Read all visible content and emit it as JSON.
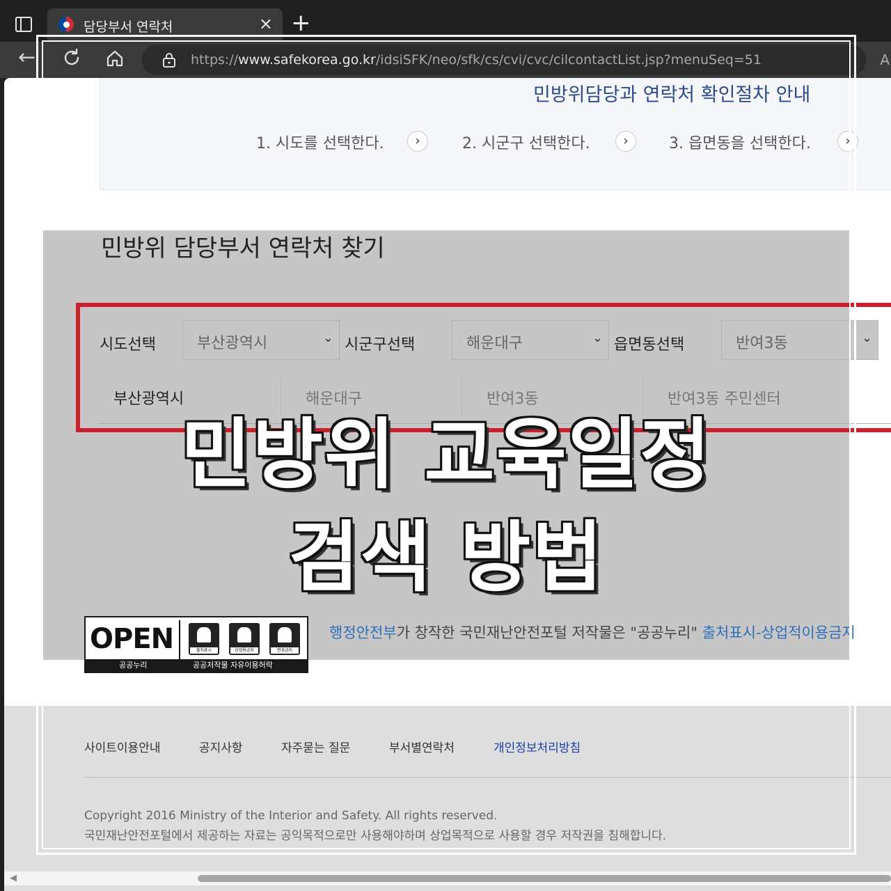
{
  "browser": {
    "tab_title": "담당부서 연락처",
    "tab_close": "×",
    "new_tab": "+",
    "url_prefix": "https://",
    "url_host": "www.safekorea.go.kr",
    "url_path": "/idsiSFK/neo/sfk/cs/cvi/cvc/cilcontactList.jsp?menuSeq=51",
    "back_glyph": "←",
    "reader_glyph": "A"
  },
  "steps": {
    "title": "민방위담당과 연락처 확인절차 안내",
    "items": [
      "1. 시도를 선택한다.",
      "2. 시군구 선택한다.",
      "3. 읍면동을 선택한다."
    ],
    "arrow": "›"
  },
  "search": {
    "title": "민방위 담당부서 연락처 찾기",
    "fields": [
      {
        "label": "시도선택",
        "value": "부산광역시"
      },
      {
        "label": "시군구선택",
        "value": "해운대구"
      },
      {
        "label": "읍면동선택",
        "value": "반여3동"
      }
    ],
    "caret": "⌄",
    "result": [
      "부산광역시",
      "해운대구",
      "반여3동",
      "반여3동 주민센터"
    ]
  },
  "headline": {
    "line1": "민방위 교육일정",
    "line2": "검색 방법"
  },
  "license": {
    "logo": "OPEN",
    "icon_labels": [
      "출처표시",
      "상업용금지",
      "변경금지"
    ],
    "footer_left": "공공누리",
    "footer_right": "공공저작물 자유이용허락",
    "org": "행정안전부",
    "text": "가 창작한 국민재난안전포털 저작물은 \"공공누리\" ",
    "type": "출처표시-상업적이용금지"
  },
  "footer": {
    "links": [
      "사이트이용안내",
      "공지사항",
      "자주묻는 질문",
      "부서별연락처",
      "개인정보처리방침"
    ],
    "copyright": "Copyright 2016 Ministry of the Interior and Safety. All rights reserved.",
    "notice": "국민재난안전포털에서 제공하는 자료는 공익목적으로만 사용해야하며 상업목적으로 사용할 경우 저작권을 침해합니다."
  },
  "scrollbar": {
    "left_glyph": "◀"
  }
}
